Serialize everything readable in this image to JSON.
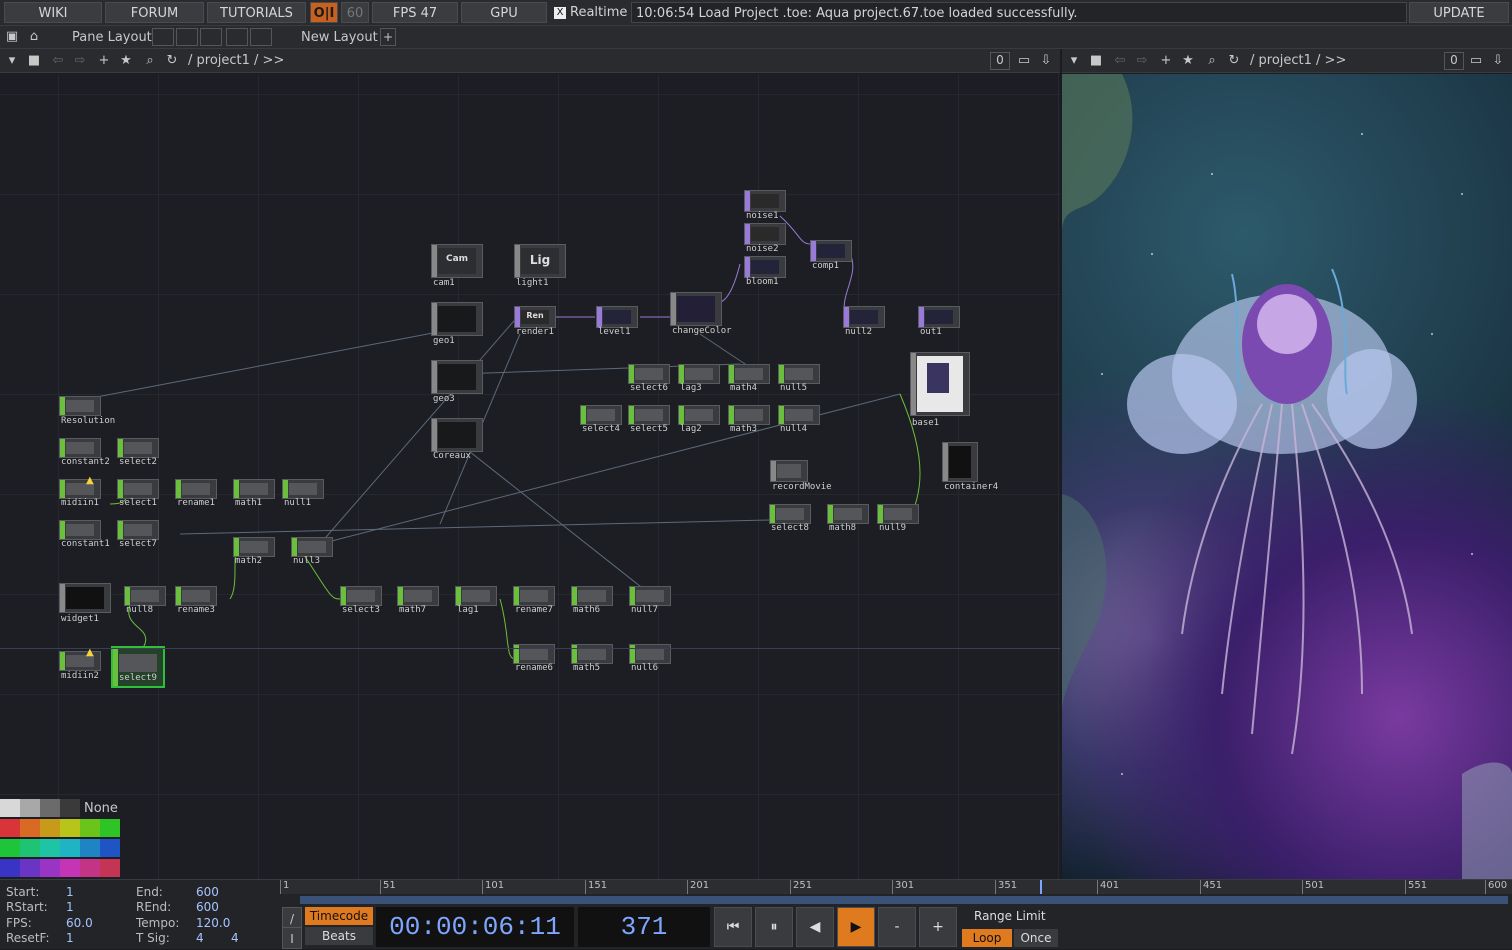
{
  "topbar": {
    "wiki": "WIKI",
    "forum": "FORUM",
    "tutorials": "TUTORIALS",
    "oi": "O|I",
    "fps_cap": "60",
    "fps_label": "FPS  47",
    "gpu": "GPU",
    "realtime_check": "X",
    "realtime": "Realtime",
    "status": "10:06:54 Load Project .toe: Aqua project.67.toe loaded successfully.",
    "update": "UPDATE"
  },
  "layoutbar": {
    "pane_layout": "Pane Layout",
    "new_layout": "New Layout",
    "plus": "+"
  },
  "pathbar_left": {
    "path": "/ project1 / >>",
    "count": "0"
  },
  "pathbar_right": {
    "path": "/ project1 / >>",
    "count": "0"
  },
  "nodes": {
    "cam": "Cam",
    "lig": "Lig",
    "ren": "Ren",
    "cam1": "cam1",
    "light1": "light1",
    "geo1": "geo1",
    "geo3": "geo3",
    "coreaux": "Coreaux",
    "render1": "render1",
    "level1": "level1",
    "changecolor": "changeColor",
    "noise1": "noise1",
    "noise2": "noise2",
    "bloom1": "bloom1",
    "comp1": "comp1",
    "null2": "null2",
    "out1": "out1",
    "base1": "base1",
    "container4": "container4",
    "recordmovie": "recordMovie",
    "select6": "select6",
    "lag3": "lag3",
    "math4": "math4",
    "null5": "null5",
    "select4": "select4",
    "select5": "select5",
    "lag2": "lag2",
    "math3": "math3",
    "null4": "null4",
    "select8": "select8",
    "math8": "math8",
    "null9": "null9",
    "resolution": "Resolution",
    "constant2": "constant2",
    "select2": "select2",
    "midiin1": "midiin1",
    "select1": "select1",
    "rename1": "rename1",
    "math1": "math1",
    "null1": "null1",
    "constant1": "constant1",
    "select7": "select7",
    "math2": "math2",
    "null3": "null3",
    "widget1": "widget1",
    "null8": "null8",
    "rename3": "rename3",
    "select3": "select3",
    "math7": "math7",
    "lag1": "lag1",
    "rename7": "rename7",
    "math6": "math6",
    "null7": "null7",
    "midiin2": "midiin2",
    "select9": "select9",
    "rename6": "rename6",
    "math5": "math5",
    "null6": "null6"
  },
  "palette": {
    "none": "None"
  },
  "info": {
    "start_l": "Start:",
    "start_v": "1",
    "rstart_l": "RStart:",
    "rstart_v": "1",
    "fps_l": "FPS:",
    "fps_v": "60.0",
    "resetf_l": "ResetF:",
    "resetf_v": "1",
    "end_l": "End:",
    "end_v": "600",
    "rend_l": "REnd:",
    "rend_v": "600",
    "tempo_l": "Tempo:",
    "tempo_v": "120.0",
    "tsig_l": "T Sig:",
    "tsig_v1": "4",
    "tsig_v2": "4"
  },
  "ruler": [
    "1",
    "51",
    "101",
    "151",
    "201",
    "251",
    "301",
    "351",
    "401",
    "451",
    "501",
    "551",
    "600"
  ],
  "timeline": {
    "timecode": "Timecode",
    "beats": "Beats",
    "time": "00:00:06:11",
    "frame": "371",
    "range_limit": "Range Limit",
    "loop": "Loop",
    "once": "Once",
    "slash": "/",
    "bar": "I",
    "minus": "-",
    "plus": "+"
  }
}
